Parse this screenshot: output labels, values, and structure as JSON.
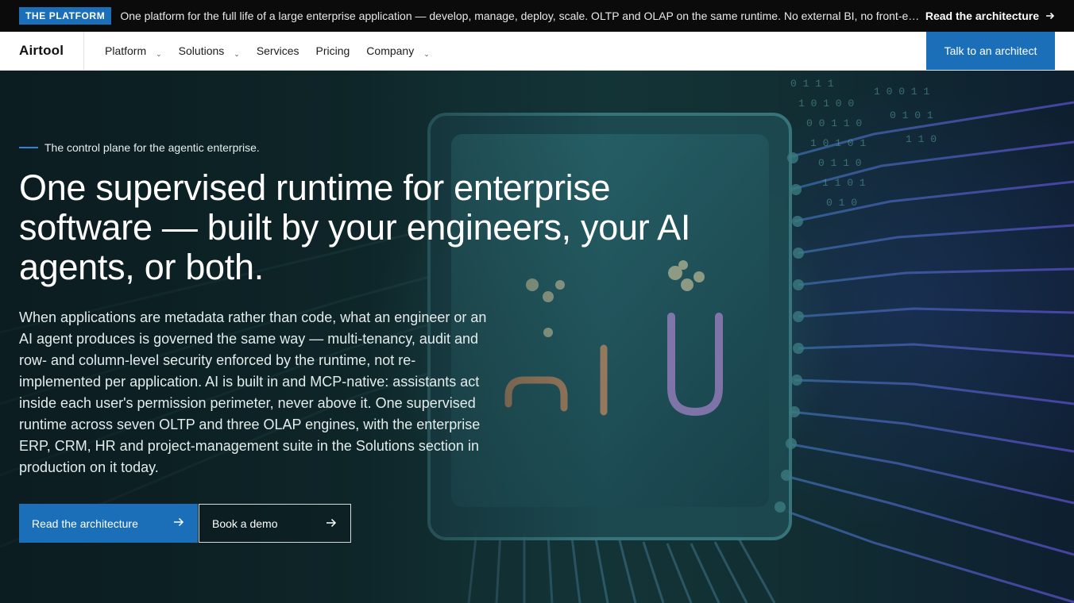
{
  "announcement": {
    "badge": "THE PLATFORM",
    "message": "One platform for the full life of a large enterprise application — develop, manage, deploy, scale. OLTP and OLAP on the same runtime. No external BI, no front-end framework, no separate toolchain.",
    "link_label": "Read the architecture"
  },
  "nav": {
    "logo": "Airtool",
    "items": [
      {
        "label": "Platform",
        "has_dropdown": true
      },
      {
        "label": "Solutions",
        "has_dropdown": true
      },
      {
        "label": "Services",
        "has_dropdown": false
      },
      {
        "label": "Pricing",
        "has_dropdown": false
      },
      {
        "label": "Company",
        "has_dropdown": true
      }
    ],
    "cta_label": "Talk to an architect"
  },
  "hero": {
    "eyebrow": "The control plane for the agentic enterprise.",
    "headline": "One supervised runtime for enterprise software — built by your engineers, your AI agents, or both.",
    "body": "When applications are metadata rather than code, what an engineer or an AI agent produces is governed the same way — multi-tenancy, audit and row- and column-level security enforced by the runtime, not re-implemented per application. AI is built in and MCP-native: assistants act inside each user's permission perimeter, never above it. One supervised runtime across seven OLTP and three OLAP engines, with the enterprise ERP, CRM, HR and project-management suite in the Solutions section in production on it today.",
    "primary_button": "Read the architecture",
    "secondary_button": "Book a demo"
  },
  "colors": {
    "accent": "#1a6fb8",
    "announce_bg": "#0b0b0b",
    "nav_bg": "#ffffff",
    "hero_bg": "#14383b"
  },
  "icons": {
    "arrow": "arrow-right-icon",
    "chevron": "chevron-down-icon"
  }
}
